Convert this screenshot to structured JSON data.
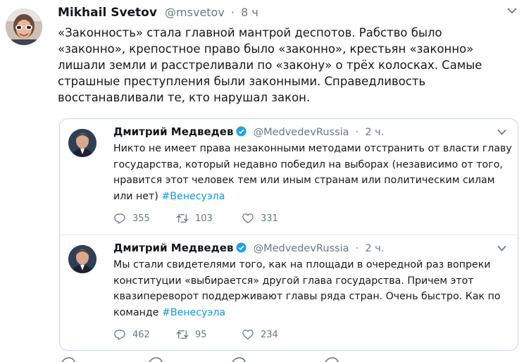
{
  "tweet": {
    "author_name": "Mikhail Svetov",
    "handle": "@msvetov",
    "separator": "·",
    "time": "8 ч",
    "text": "«Законность» стала главной мантрой деспотов. Рабство было «законно», крепостное право было «законно», крестьян «законно» лишали земли и расстреливали по «закону» о трёх колосках. Самые страшные преступления были законными. Справедливость восстанавливали те, кто нарушал закон.",
    "menu_icon": "chevron-down-icon"
  },
  "quoted_thread": [
    {
      "author_name": "Дмитрий Медведев",
      "handle": "@MedvedevRussia",
      "separator": "·",
      "time": "2 ч.",
      "text": "Никто не имеет права незаконными методами отстранить от власти главу государства, который недавно победил на выборах (независимо от того, нравится этот человек тем или иным странам или политическим силам или нет)",
      "hashtag": "#Венесуэла",
      "replies": "355",
      "retweets": "103",
      "likes": "331"
    },
    {
      "author_name": "Дмитрий Медведев",
      "handle": "@MedvedevRussia",
      "separator": "·",
      "time": "2 ч.",
      "text": "Мы стали свидетелями того, как на площади в очередной раз вопреки конституции «выбирается» другой глава государства. Причем этот квазипереворот поддерживают главы ряда стран. Очень быстро. Как по команде",
      "hashtag": "#Венесуэла",
      "replies": "462",
      "retweets": "95",
      "likes": "234"
    }
  ],
  "colors": {
    "text": "#14171a",
    "secondary": "#657786",
    "link": "#1b95e0",
    "border": "#ccd6dd",
    "verified": "#1da1f2"
  }
}
